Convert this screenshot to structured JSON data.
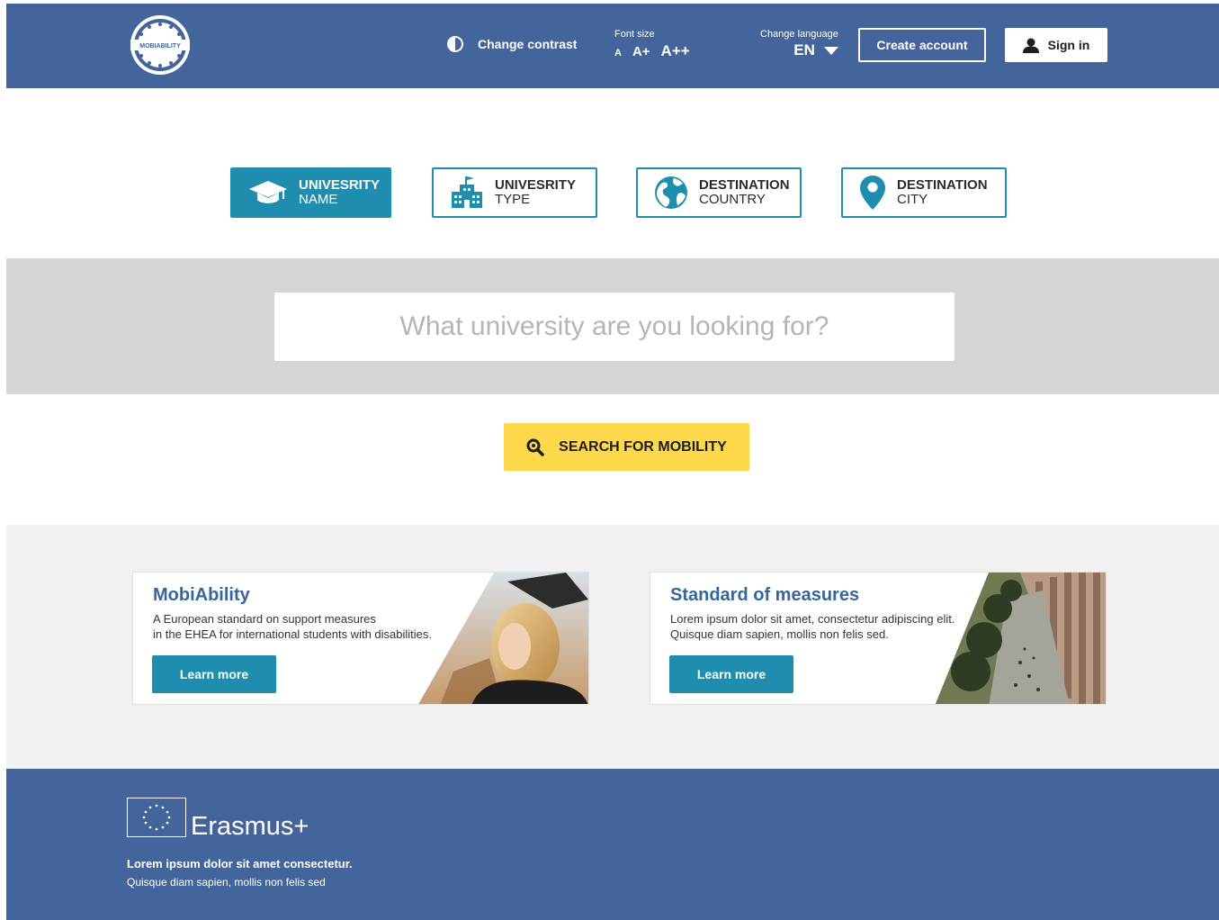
{
  "header": {
    "logo_text": "MOBIABILITY",
    "contrast_label": "Change contrast",
    "font_size_caption": "Font size",
    "font_sizes": [
      "A",
      "A+",
      "A++"
    ],
    "language_caption": "Change language",
    "language_value": "EN",
    "create_account_label": "Create account",
    "sign_in_label": "Sign in",
    "colors": {
      "bar": "#44649c"
    }
  },
  "tabs": [
    {
      "line1": "UNIVESRITY",
      "line2": "NAME",
      "icon": "graduation-cap-icon",
      "active": true
    },
    {
      "line1": "UNIVESRITY",
      "line2": "TYPE",
      "icon": "university-building-icon",
      "active": false
    },
    {
      "line1": "DESTINATION",
      "line2": "COUNTRY",
      "icon": "globe-icon",
      "active": false
    },
    {
      "line1": "DESTINATION",
      "line2": "CITY",
      "icon": "map-pin-icon",
      "active": false
    }
  ],
  "search": {
    "placeholder": "What university are you looking for?",
    "value": "",
    "button_label": "SEARCH FOR MOBILITY",
    "button_icon": "search-icon",
    "colors": {
      "accent": "#1f8eae",
      "button": "#fdd84a"
    }
  },
  "cards": [
    {
      "title": "MobiAbility",
      "desc_line1": "A European standard on support measures",
      "desc_line2": "in the EHEA for international students with disabilities.",
      "button_label": "Learn more"
    },
    {
      "title": "Standard of measures",
      "desc_line1": "Lorem ipsum dolor sit amet, consectetur adipiscing elit.",
      "desc_line2": "Quisque diam sapien, mollis non felis sed.",
      "button_label": "Learn more"
    }
  ],
  "footer": {
    "brand": "Erasmus+",
    "line1": "Lorem ipsum dolor sit amet consectetur.",
    "line2": "Quisque diam sapien, mollis non felis sed"
  }
}
